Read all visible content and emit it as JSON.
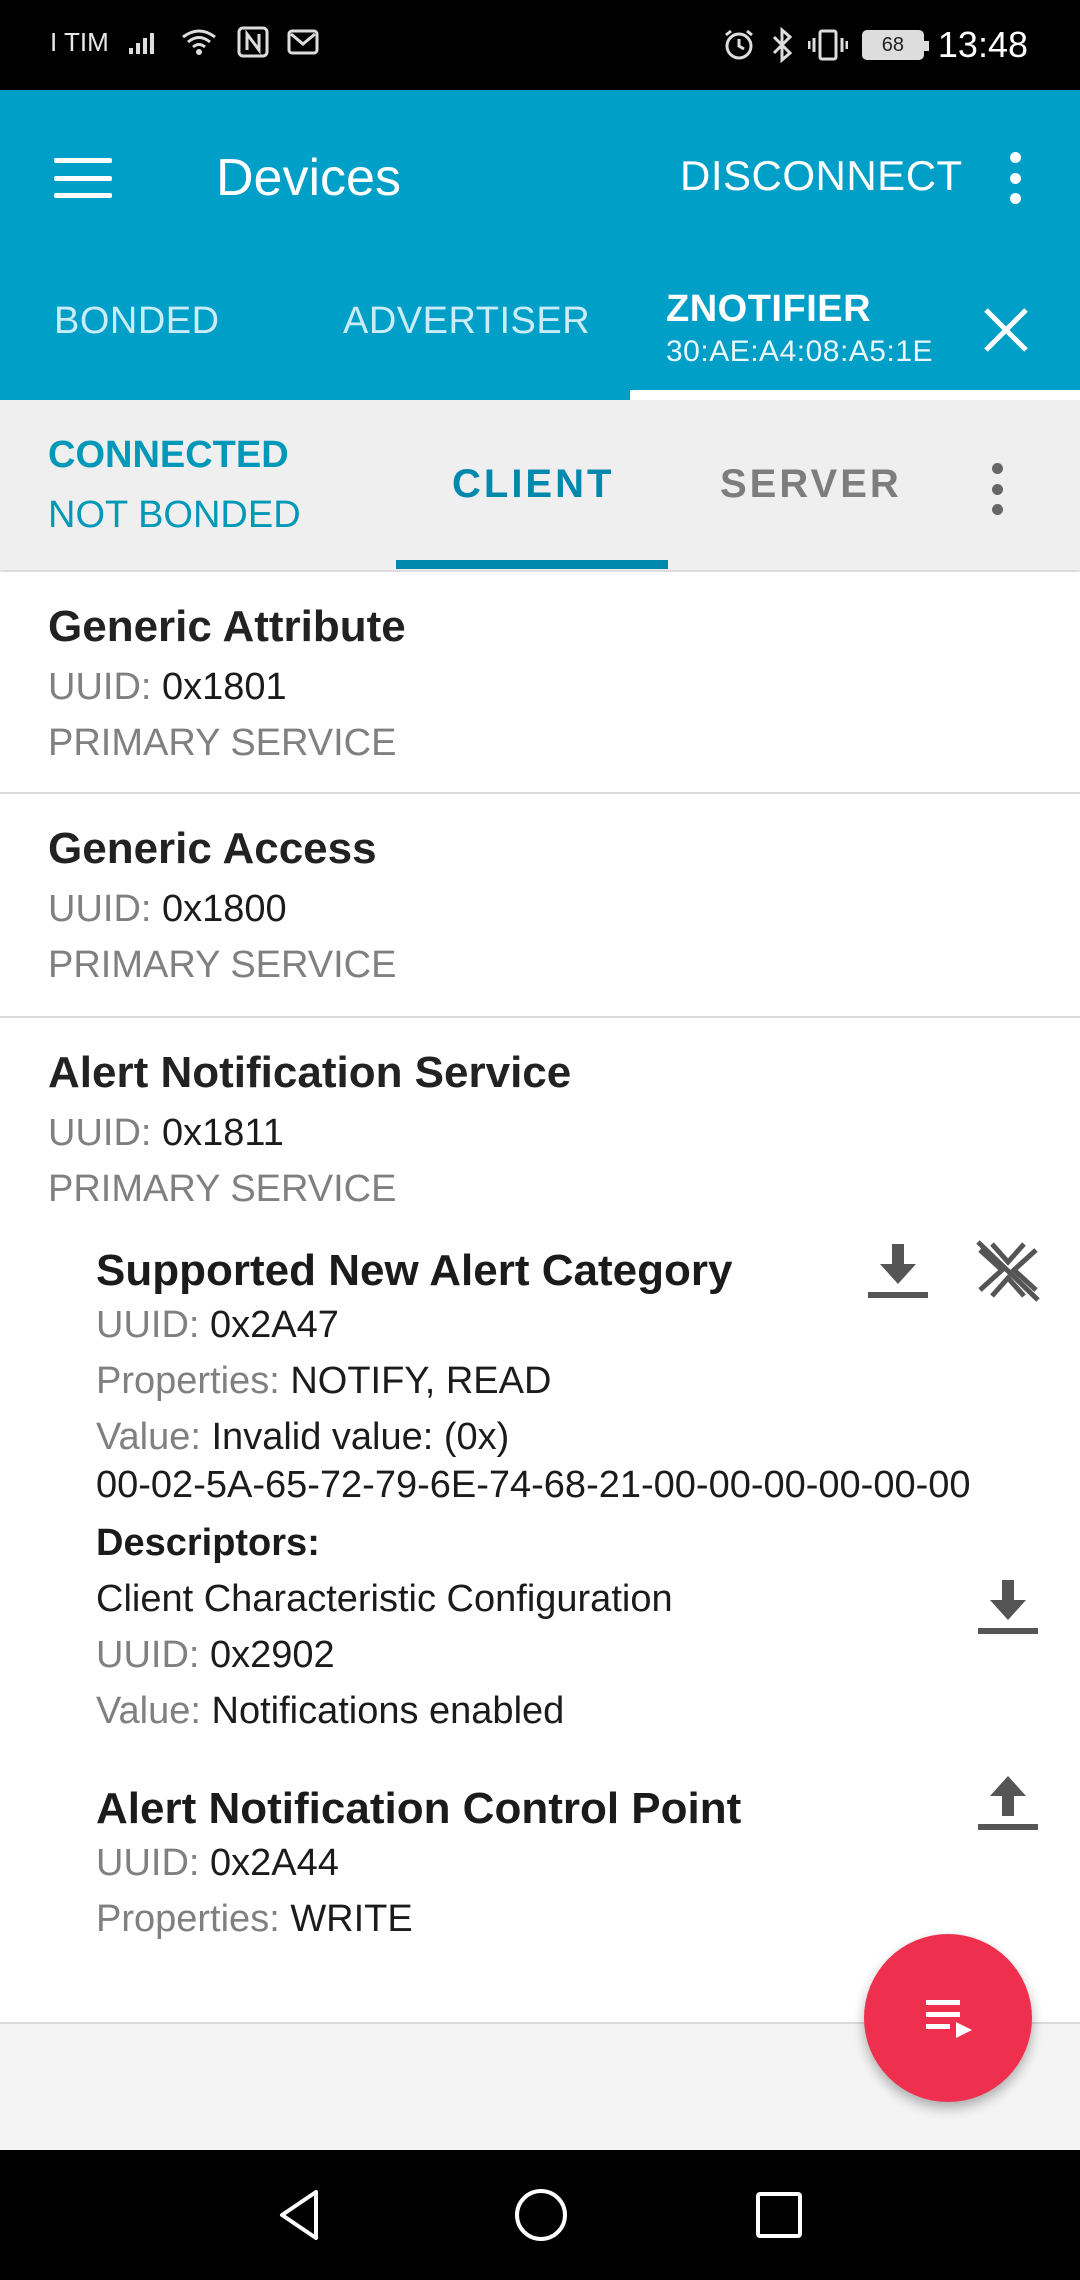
{
  "status_bar": {
    "carrier": "I TIM",
    "time": "13:48",
    "battery": "68"
  },
  "app_bar": {
    "title": "Devices",
    "disconnect_label": "DISCONNECT",
    "tabs": [
      {
        "label": "BONDED"
      },
      {
        "label": "ADVERTISER"
      }
    ],
    "device_tab": {
      "name": "ZNOTIFIER",
      "address": "30:AE:A4:08:A5:1E"
    }
  },
  "sub_header": {
    "connection_state": "CONNECTED",
    "bond_state": "NOT BONDED",
    "tabs": [
      {
        "label": "CLIENT",
        "selected": true
      },
      {
        "label": "SERVER",
        "selected": false
      }
    ]
  },
  "labels": {
    "uuid": "UUID:",
    "properties": "Properties:",
    "value": "Value:",
    "descriptors": "Descriptors:"
  },
  "services": [
    {
      "name": "Generic Attribute",
      "uuid": "0x1801",
      "type": "PRIMARY SERVICE"
    },
    {
      "name": "Generic Access",
      "uuid": "0x1800",
      "type": "PRIMARY SERVICE"
    },
    {
      "name": "Alert Notification Service",
      "uuid": "0x1811",
      "type": "PRIMARY SERVICE"
    }
  ],
  "characteristics": [
    {
      "name": "Supported New Alert Category",
      "uuid": "0x2A47",
      "properties": "NOTIFY, READ",
      "value_line1": "Invalid value: (0x)",
      "value_line2": "00-02-5A-65-72-79-6E-74-68-21-00-00-00-00-00-00",
      "descriptor": {
        "name": "Client Characteristic Configuration",
        "uuid": "0x2902",
        "value": "Notifications enabled"
      }
    },
    {
      "name": "Alert Notification Control Point",
      "uuid": "0x2A44",
      "properties": "WRITE"
    }
  ],
  "colors": {
    "app_bar": "#009fc7",
    "accent": "#0088ad",
    "fab": "#ee2f4e"
  },
  "icons": {
    "menu": "menu-icon",
    "overflow": "more-vert-icon",
    "close": "close-icon",
    "read": "download-icon",
    "notify_off": "notifications-off-icon",
    "write": "upload-icon",
    "fab": "log-icon",
    "nav_back": "back-triangle-icon",
    "nav_home": "home-circle-icon",
    "nav_recents": "recents-square-icon"
  }
}
